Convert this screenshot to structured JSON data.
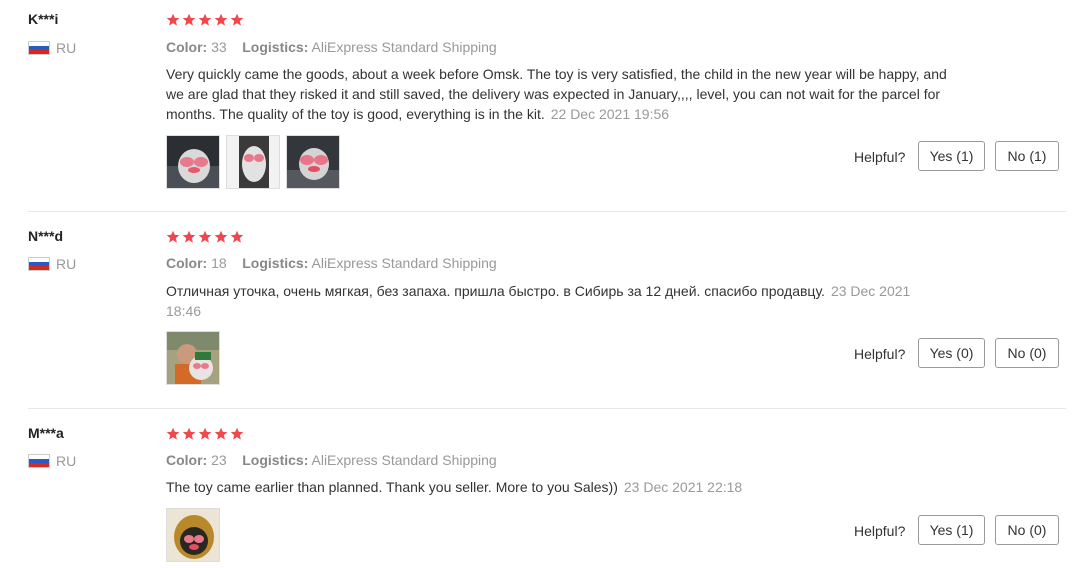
{
  "colors": {
    "star": "#f0474f",
    "muted": "#999999",
    "text": "#333333"
  },
  "helpful_label": "Helpful?",
  "labels": {
    "color": "Color:",
    "logistics": "Logistics:"
  },
  "reviews": [
    {
      "user": "K***i",
      "country": "RU",
      "rating": 5,
      "color": "33",
      "logistics": "AliExpress Standard Shipping",
      "text": "Very quickly came the goods, about a week before Omsk. The toy is very satisfied, the child in the new year will be happy, and we are glad that they risked it and still saved, the delivery was expected in January,,,, level, you can not wait for the parcel for months. The quality of the toy is good, everything is in the kit.",
      "date": "22 Dec 2021 19:56",
      "photo_count": 3,
      "yes": "Yes (1)",
      "no": "No (1)"
    },
    {
      "user": "N***d",
      "country": "RU",
      "rating": 5,
      "color": "18",
      "logistics": "AliExpress Standard Shipping",
      "text": "Отличная уточка, очень мягкая, без запаха. пришла быстро. в Сибирь за 12 дней. спасибо продавцу.",
      "date": "23 Dec 2021 18:46",
      "photo_count": 1,
      "yes": "Yes (0)",
      "no": "No (0)"
    },
    {
      "user": "M***a",
      "country": "RU",
      "rating": 5,
      "color": "23",
      "logistics": "AliExpress Standard Shipping",
      "text": "The toy came earlier than planned. Thank you seller. More to you Sales))",
      "date": "23 Dec 2021 22:18",
      "photo_count": 1,
      "yes": "Yes (1)",
      "no": "No (0)"
    }
  ]
}
